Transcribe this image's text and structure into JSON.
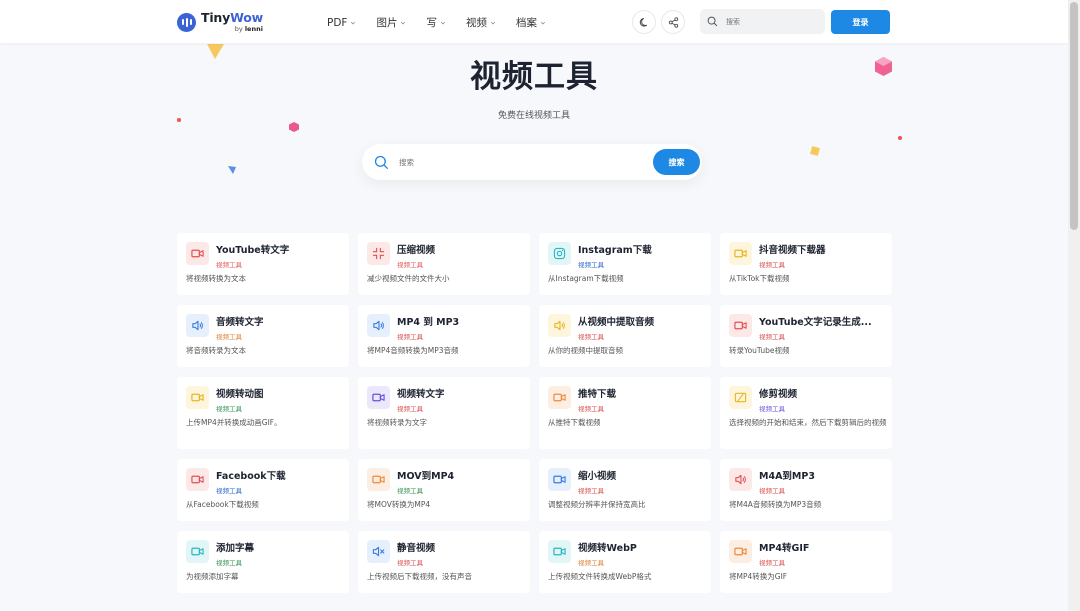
{
  "header": {
    "logo_title_a": "Tiny",
    "logo_title_b": "Wow",
    "logo_by": "by ",
    "logo_brand": "lenni",
    "nav": [
      "PDF",
      "图片",
      "写",
      "视频",
      "档案"
    ],
    "search_placeholder": "搜索",
    "login": "登录"
  },
  "hero": {
    "title": "视频工具",
    "subtitle": "免费在线视频工具",
    "search_placeholder": "搜索",
    "search_button": "搜索"
  },
  "colors": {
    "accent": "#1e88e5",
    "brand": "#3b63d6"
  },
  "tools": [
    {
      "title": "YouTube转文字",
      "tag": "视频工具",
      "desc": "将视频转换为文本",
      "icon": "video-camera-icon",
      "bg": "#fde8e8",
      "fg": "#e05252",
      "tagColor": "#e05252"
    },
    {
      "title": "压缩视频",
      "tag": "视频工具",
      "desc": "减少视频文件的文件大小",
      "icon": "compress-icon",
      "bg": "#fde8e8",
      "fg": "#e05252",
      "tagColor": "#e05252"
    },
    {
      "title": "Instagram下载",
      "tag": "视频工具",
      "desc": "从Instagram下载视频",
      "icon": "instagram-icon",
      "bg": "#e3f6f7",
      "fg": "#28b6c4",
      "tagColor": "#2563c9"
    },
    {
      "title": "抖音视频下载器",
      "tag": "视频工具",
      "desc": "从TikTok下载视频",
      "icon": "video-camera-icon",
      "bg": "#fef6dc",
      "fg": "#e8b522",
      "tagColor": "#d84a4a"
    },
    {
      "title": "音频转文字",
      "tag": "视频工具",
      "desc": "将音频转录为文本",
      "icon": "speaker-icon",
      "bg": "#e6effc",
      "fg": "#3a7be0",
      "tagColor": "#e07a2a"
    },
    {
      "title": "MP4 到 MP3",
      "tag": "视频工具",
      "desc": "将MP4音频转换为MP3音频",
      "icon": "speaker-icon",
      "bg": "#e6effc",
      "fg": "#3a7be0",
      "tagColor": "#d84a4a"
    },
    {
      "title": "从视频中提取音频",
      "tag": "视频工具",
      "desc": "从你的视频中提取音频",
      "icon": "speaker-icon",
      "bg": "#fef6dc",
      "fg": "#e8b522",
      "tagColor": "#d84a4a"
    },
    {
      "title": "YouTube文字记录生成...",
      "tag": "视频工具",
      "desc": "转录YouTube视频",
      "icon": "video-camera-icon",
      "bg": "#fde8e8",
      "fg": "#e05252",
      "tagColor": "#d84a4a"
    },
    {
      "title": "视频转动图",
      "tag": "视频工具",
      "desc": "上传MP4并转换成动画GIF。",
      "icon": "video-camera-icon",
      "bg": "#fef6dc",
      "fg": "#e8b522",
      "tagColor": "#2f8f4e"
    },
    {
      "title": "视频转文字",
      "tag": "视频工具",
      "desc": "将视频转录为文字",
      "icon": "video-camera-icon",
      "bg": "#ece8fb",
      "fg": "#6a4fd8",
      "tagColor": "#d84a4a"
    },
    {
      "title": "推特下载",
      "tag": "视频工具",
      "desc": "从推特下载视频",
      "icon": "video-camera-icon",
      "bg": "#fdeee3",
      "fg": "#ef8a3c",
      "tagColor": "#d84a4a"
    },
    {
      "title": "修剪视频",
      "tag": "视频工具",
      "desc": "选择视频的开始和结束，然后下载剪辑后的视频",
      "icon": "trim-icon",
      "bg": "#fef6dc",
      "fg": "#e8b522",
      "tagColor": "#6a4fd8"
    },
    {
      "title": "Facebook下载",
      "tag": "视频工具",
      "desc": "从Facebook下载视频",
      "icon": "video-camera-icon",
      "bg": "#fde8e8",
      "fg": "#e05252",
      "tagColor": "#2563c9"
    },
    {
      "title": "MOV到MP4",
      "tag": "视频工具",
      "desc": "将MOV转换为MP4",
      "icon": "video-camera-icon",
      "bg": "#fdeee3",
      "fg": "#ef8a3c",
      "tagColor": "#2f8f4e"
    },
    {
      "title": "缩小视频",
      "tag": "视频工具",
      "desc": "调整视频分辨率并保持宽高比",
      "icon": "video-camera-icon",
      "bg": "#e6effc",
      "fg": "#3a7be0",
      "tagColor": "#d84a4a"
    },
    {
      "title": "M4A到MP3",
      "tag": "视频工具",
      "desc": "将M4A音频转换为MP3音频",
      "icon": "speaker-icon",
      "bg": "#fde8e8",
      "fg": "#e05252",
      "tagColor": "#d84a4a"
    },
    {
      "title": "添加字幕",
      "tag": "视频工具",
      "desc": "为视频添加字幕",
      "icon": "video-camera-icon",
      "bg": "#e3f6f7",
      "fg": "#28b6c4",
      "tagColor": "#2f8f4e"
    },
    {
      "title": "静音视频",
      "tag": "视频工具",
      "desc": "上传视频后下载视频，没有声音",
      "icon": "mute-icon",
      "bg": "#e6effc",
      "fg": "#3a7be0",
      "tagColor": "#d84a4a"
    },
    {
      "title": "视频转WebP",
      "tag": "视频工具",
      "desc": "上传视频文件转换成WebP格式",
      "icon": "video-camera-icon",
      "bg": "#e3f6f7",
      "fg": "#28b6c4",
      "tagColor": "#e07a2a"
    },
    {
      "title": "MP4转GIF",
      "tag": "视频工具",
      "desc": "将MP4转换为GIF",
      "icon": "video-camera-icon",
      "bg": "#fdeee3",
      "fg": "#ef8a3c",
      "tagColor": "#d84a4a"
    }
  ]
}
